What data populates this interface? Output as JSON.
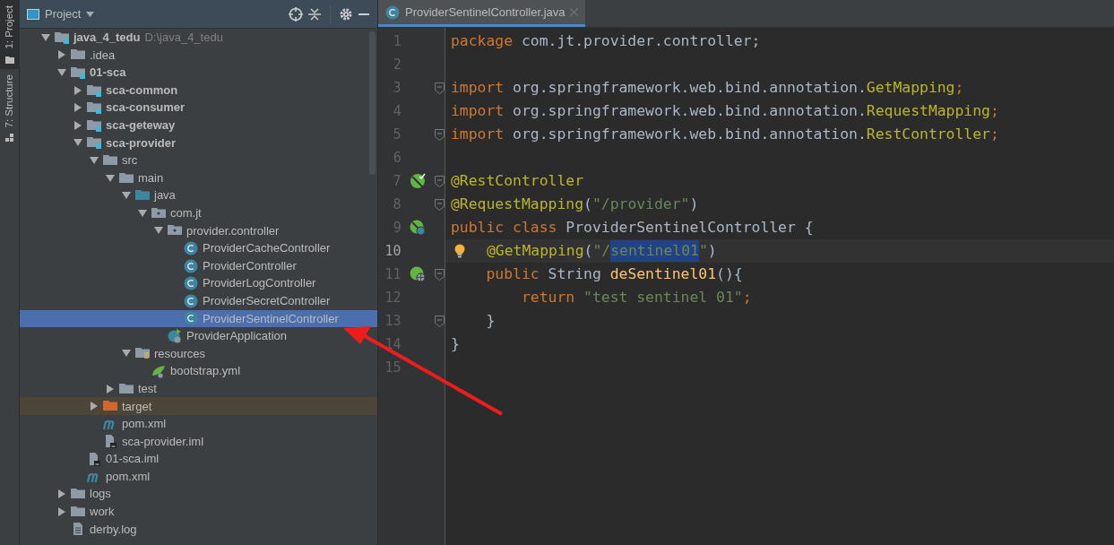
{
  "side_tabs": [
    {
      "label": "1: Project",
      "kind": "project",
      "selected": true
    },
    {
      "label": "7: Structure",
      "kind": "structure",
      "selected": false
    }
  ],
  "project_panel": {
    "title": "Project",
    "tree": [
      {
        "label": "java_4_tedu",
        "hint": "D:\\java_4_tedu",
        "kind": "module",
        "expanded": true,
        "selected": false,
        "children": [
          {
            "label": ".idea",
            "kind": "folder",
            "expanded": false,
            "selected": false
          },
          {
            "label": "01-sca",
            "kind": "module",
            "expanded": true,
            "selected": false,
            "children": [
              {
                "label": "sca-common",
                "kind": "module",
                "expanded": false,
                "selected": false
              },
              {
                "label": "sca-consumer",
                "kind": "module",
                "expanded": false,
                "selected": false
              },
              {
                "label": "sca-geteway",
                "kind": "module",
                "expanded": false,
                "selected": false
              },
              {
                "label": "sca-provider",
                "kind": "module",
                "expanded": true,
                "selected": false,
                "children": [
                  {
                    "label": "src",
                    "kind": "folder",
                    "expanded": true,
                    "selected": false,
                    "children": [
                      {
                        "label": "main",
                        "kind": "folder",
                        "expanded": true,
                        "selected": false,
                        "children": [
                          {
                            "label": "java",
                            "kind": "source",
                            "expanded": true,
                            "selected": false,
                            "children": [
                              {
                                "label": "com.jt",
                                "kind": "package",
                                "expanded": true,
                                "selected": false,
                                "children": [
                                  {
                                    "label": "provider.controller",
                                    "kind": "package",
                                    "expanded": true,
                                    "selected": false,
                                    "children": [
                                      {
                                        "label": "ProviderCacheController",
                                        "kind": "class",
                                        "selected": false
                                      },
                                      {
                                        "label": "ProviderController",
                                        "kind": "class",
                                        "selected": false
                                      },
                                      {
                                        "label": "ProviderLogController",
                                        "kind": "class",
                                        "selected": false
                                      },
                                      {
                                        "label": "ProviderSecretController",
                                        "kind": "class",
                                        "selected": false
                                      },
                                      {
                                        "label": "ProviderSentinelController",
                                        "kind": "class",
                                        "selected": true
                                      }
                                    ]
                                  },
                                  {
                                    "label": "ProviderApplication",
                                    "kind": "app",
                                    "selected": false
                                  }
                                ]
                              }
                            ]
                          },
                          {
                            "label": "resources",
                            "kind": "resources",
                            "expanded": true,
                            "selected": false,
                            "children": [
                              {
                                "label": "bootstrap.yml",
                                "kind": "yml",
                                "selected": false
                              }
                            ]
                          }
                        ]
                      },
                      {
                        "label": "test",
                        "kind": "folder",
                        "expanded": false,
                        "selected": false
                      }
                    ]
                  },
                  {
                    "label": "target",
                    "kind": "target",
                    "expanded": false,
                    "selected": false
                  },
                  {
                    "label": "pom.xml",
                    "kind": "maven",
                    "selected": false
                  },
                  {
                    "label": "sca-provider.iml",
                    "kind": "iml",
                    "selected": false
                  }
                ]
              },
              {
                "label": "01-sca.iml",
                "kind": "iml",
                "selected": false
              },
              {
                "label": "pom.xml",
                "kind": "maven",
                "selected": false
              }
            ]
          },
          {
            "label": "logs",
            "kind": "folder",
            "expanded": false,
            "selected": false
          },
          {
            "label": "work",
            "kind": "folder",
            "expanded": false,
            "selected": false
          },
          {
            "label": "derby.log",
            "kind": "log",
            "selected": false
          }
        ]
      }
    ]
  },
  "editor": {
    "tabs": [
      {
        "label": "ProviderSentinelController.java",
        "selected": true
      }
    ],
    "lines": [
      {
        "number": "1",
        "current": false,
        "tokens": [
          {
            "text": "package",
            "kind": "keyword"
          },
          {
            "text": " com.jt.provider.controller;",
            "kind": "plain"
          }
        ]
      },
      {
        "number": "2",
        "current": false
      },
      {
        "number": "3",
        "current": false,
        "fold": true,
        "tokens": [
          {
            "text": "import",
            "kind": "keyword"
          },
          {
            "text": " org.springframework.web.bind.annotation.",
            "kind": "plain"
          },
          {
            "text": "GetMapping",
            "kind": "annotation"
          },
          {
            "text": ";",
            "kind": "keyword"
          }
        ]
      },
      {
        "number": "4",
        "current": false,
        "tokens": [
          {
            "text": "import",
            "kind": "keyword"
          },
          {
            "text": " org.springframework.web.bind.annotation.",
            "kind": "plain"
          },
          {
            "text": "RequestMapping",
            "kind": "annotation"
          },
          {
            "text": ";",
            "kind": "keyword"
          }
        ]
      },
      {
        "number": "5",
        "current": false,
        "fold": true,
        "tokens": [
          {
            "text": "import",
            "kind": "keyword"
          },
          {
            "text": " org.springframework.web.bind.annotation.",
            "kind": "plain"
          },
          {
            "text": "RestController",
            "kind": "annotation"
          },
          {
            "text": ";",
            "kind": "keyword"
          }
        ]
      },
      {
        "number": "6",
        "current": false
      },
      {
        "number": "7",
        "current": false,
        "fold": true,
        "marker": {
          "kind": "bean"
        },
        "tokens": [
          {
            "text": "@RestController",
            "kind": "annotation"
          }
        ]
      },
      {
        "number": "8",
        "current": false,
        "fold": true,
        "tokens": [
          {
            "text": "@RequestMapping",
            "kind": "annotation"
          },
          {
            "text": "(",
            "kind": "plain"
          },
          {
            "text": "\"/provider\"",
            "kind": "string"
          },
          {
            "text": ")",
            "kind": "plain"
          }
        ]
      },
      {
        "number": "9",
        "current": false,
        "marker": {
          "kind": "bean-globe"
        },
        "tokens": [
          {
            "text": "public class",
            "kind": "keyword"
          },
          {
            "text": " ProviderSentinelController {",
            "kind": "plain"
          }
        ]
      },
      {
        "number": "10",
        "current": true,
        "marker": {
          "kind": "bulb"
        },
        "tokens": [
          {
            "text": "@GetMapping",
            "kind": "annotation"
          },
          {
            "text": "(",
            "kind": "plain"
          },
          {
            "text": "\"/",
            "kind": "string"
          },
          {
            "text": "sentinel01",
            "kind": "string",
            "selected": true
          },
          {
            "text": "\"",
            "kind": "string"
          },
          {
            "text": ")",
            "kind": "plain"
          }
        ]
      },
      {
        "number": "11",
        "current": false,
        "fold": true,
        "marker": {
          "kind": "globe"
        },
        "tokens": [
          {
            "text": "    public",
            "kind": "keyword"
          },
          {
            "text": " String ",
            "kind": "plain"
          },
          {
            "text": "deSentinel01",
            "kind": "method"
          },
          {
            "text": "(){",
            "kind": "plain"
          }
        ]
      },
      {
        "number": "12",
        "current": false,
        "tokens": [
          {
            "text": "        return",
            "kind": "keyword"
          },
          {
            "text": " \"test sentinel 01\"",
            "kind": "string"
          },
          {
            "text": ";",
            "kind": "keyword"
          }
        ]
      },
      {
        "number": "13",
        "current": false,
        "fold": true,
        "tokens": [
          {
            "text": "    }",
            "kind": "plain"
          }
        ]
      },
      {
        "number": "14",
        "current": false,
        "tokens": [
          {
            "text": "}",
            "kind": "plain"
          }
        ]
      },
      {
        "number": "15",
        "current": false
      }
    ]
  }
}
